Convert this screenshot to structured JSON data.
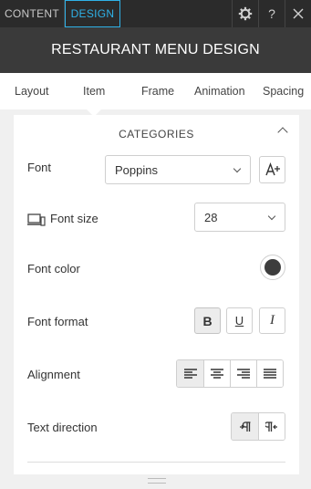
{
  "topbar": {
    "tabs": [
      {
        "label": "CONTENT"
      },
      {
        "label": "DESIGN"
      }
    ],
    "icons": [
      "gear-icon",
      "help-icon",
      "close-icon"
    ],
    "help_label": "?"
  },
  "title": "RESTAURANT MENU DESIGN",
  "subtabs": [
    {
      "label": "Layout"
    },
    {
      "label": "Item"
    },
    {
      "label": "Frame"
    },
    {
      "label": "Animation"
    },
    {
      "label": "Spacing"
    }
  ],
  "section": {
    "title": "CATEGORIES"
  },
  "fields": {
    "font": {
      "label": "Font",
      "value": "Poppins"
    },
    "font_size": {
      "label": "Font size",
      "value": "28"
    },
    "font_color": {
      "label": "Font color",
      "color": "#3d3d3d"
    },
    "font_format": {
      "label": "Font format",
      "bold": "B",
      "underline": "U",
      "italic": "I"
    },
    "alignment": {
      "label": "Alignment"
    },
    "text_direction": {
      "label": "Text direction"
    }
  },
  "colors": {
    "accent": "#2fb2e8",
    "topbar_bg": "#2b2b2b",
    "titlebar_bg": "#3a3a3a"
  }
}
